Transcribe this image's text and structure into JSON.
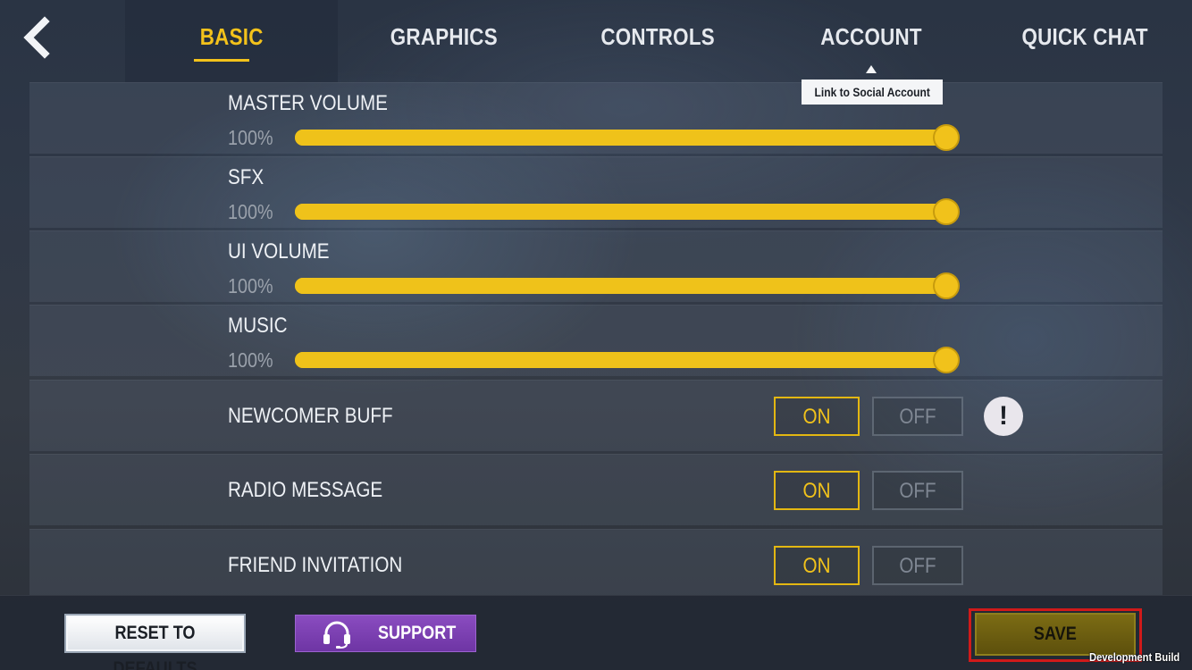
{
  "nav": {
    "back_icon": "back-chevron-icon",
    "tabs": [
      {
        "label": "BASIC",
        "active": true
      },
      {
        "label": "GRAPHICS",
        "active": false
      },
      {
        "label": "CONTROLS",
        "active": false
      },
      {
        "label": "ACCOUNT",
        "active": false
      },
      {
        "label": "QUICK CHAT",
        "active": false
      }
    ],
    "tooltip": "Link to Social Account"
  },
  "sliders": [
    {
      "label": "MASTER VOLUME",
      "value_text": "100%",
      "value": 100
    },
    {
      "label": "SFX",
      "value_text": "100%",
      "value": 100
    },
    {
      "label": "UI VOLUME",
      "value_text": "100%",
      "value": 100
    },
    {
      "label": "MUSIC",
      "value_text": "100%",
      "value": 100
    }
  ],
  "toggles": [
    {
      "label": "NEWCOMER BUFF",
      "on_label": "ON",
      "off_label": "OFF",
      "selected": "on",
      "info_icon": "!"
    },
    {
      "label": "RADIO MESSAGE",
      "on_label": "ON",
      "off_label": "OFF",
      "selected": "on"
    },
    {
      "label": "FRIEND INVITATION",
      "on_label": "ON",
      "off_label": "OFF",
      "selected": "on"
    }
  ],
  "footer": {
    "reset_label": "RESET TO DEFAULTS",
    "support_label": "SUPPORT",
    "support_icon": "headset-icon",
    "save_label": "SAVE",
    "dev_build": "Development Build"
  },
  "colors": {
    "accent": "#f1c21b",
    "support": "#7b3fb2",
    "save_highlight": "#d01a1a"
  }
}
